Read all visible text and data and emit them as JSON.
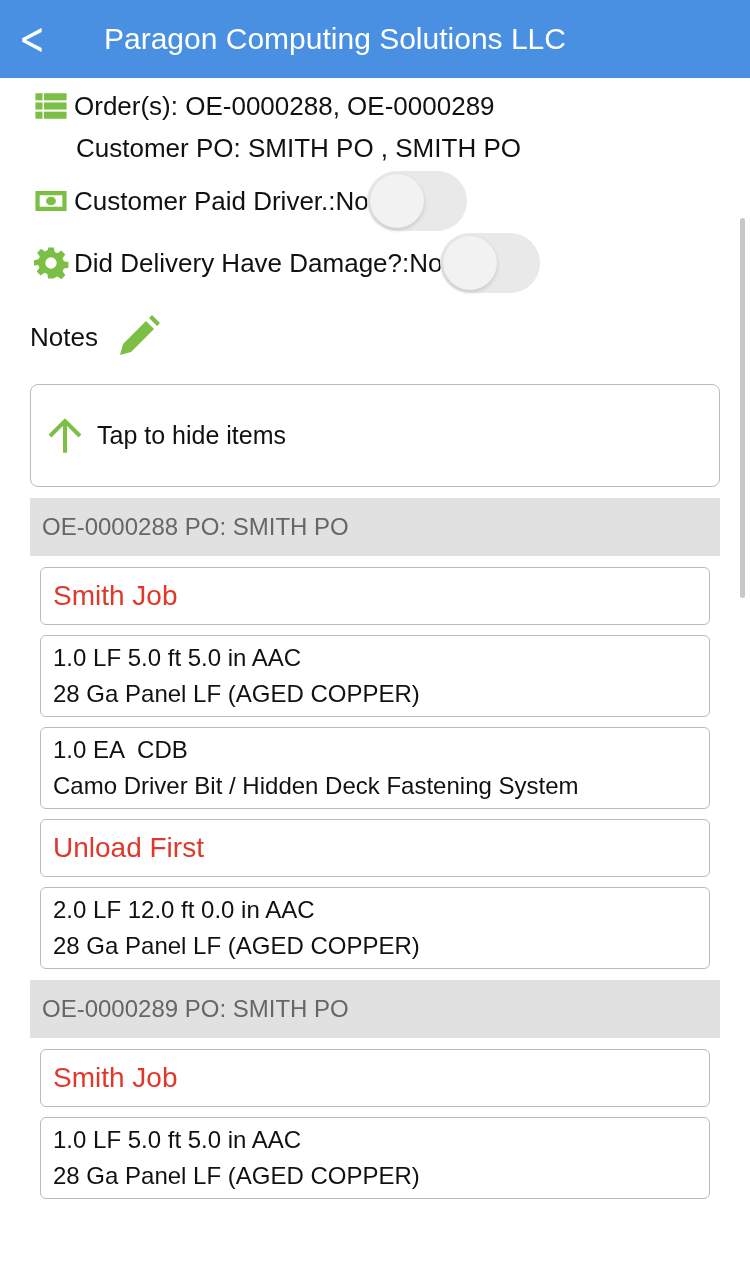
{
  "header": {
    "back": "<",
    "title": "Paragon Computing Solutions LLC"
  },
  "orders": "Order(s): OE-0000288, OE-0000289",
  "customer_po": "Customer PO: SMITH PO , SMITH PO",
  "toggles": [
    {
      "label": "Customer Paid Driver.:No",
      "on": false
    },
    {
      "label": "Did Delivery Have Damage?:No",
      "on": false
    }
  ],
  "notes": {
    "label": "Notes"
  },
  "hide_items": "Tap to hide items",
  "groups": [
    {
      "header": "OE-0000288 PO: SMITH PO",
      "items": [
        {
          "kind": "note",
          "text": "Smith Job"
        },
        {
          "kind": "line",
          "line1": "1.0 LF 5.0 ft 5.0 in AAC",
          "line2": "28 Ga Panel LF (AGED COPPER)"
        },
        {
          "kind": "line",
          "line1": "1.0 EA  CDB",
          "line2": "Camo Driver Bit / Hidden Deck Fastening System"
        },
        {
          "kind": "note",
          "text": "Unload First"
        },
        {
          "kind": "line",
          "line1": "2.0 LF 12.0 ft 0.0 in AAC",
          "line2": "28 Ga Panel LF (AGED COPPER)"
        }
      ]
    },
    {
      "header": "OE-0000289 PO: SMITH PO",
      "items": [
        {
          "kind": "note",
          "text": "Smith Job"
        },
        {
          "kind": "line",
          "line1": "1.0 LF 5.0 ft 5.0 in AAC",
          "line2": "28 Ga Panel LF (AGED COPPER)"
        }
      ]
    }
  ]
}
